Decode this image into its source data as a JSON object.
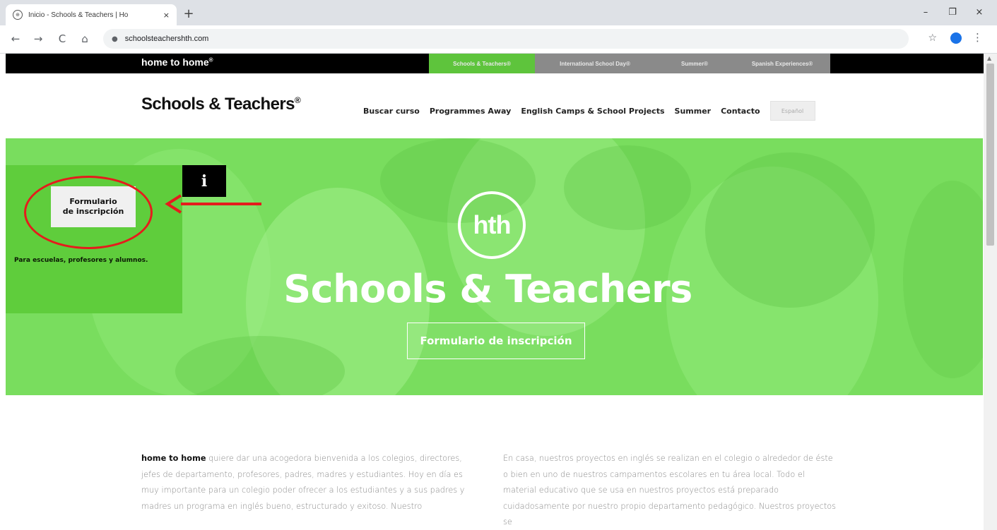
{
  "browser": {
    "tab": {
      "title": "Inicio - Schools & Teachers | Ho",
      "close": "×"
    },
    "new_tab": "+",
    "controls": {
      "minimize": "–",
      "restore": "❐",
      "close": "×"
    },
    "url": "schoolsteachershth.com",
    "nav": {
      "back": "←",
      "forward": "→",
      "reload": "C",
      "home": "⌂"
    },
    "star": "☆",
    "menu": "⋮"
  },
  "topbar": {
    "brand": "home to home",
    "brand_mark": "®",
    "tabs": [
      {
        "label": "Schools & Teachers®",
        "color": "#5ec43c"
      },
      {
        "label": "International School Day®",
        "color": "#8a8a8a"
      },
      {
        "label": "Summer®",
        "color": "#8a8a8a"
      },
      {
        "label": "Spanish Experiences®",
        "color": "#8a8a8a"
      }
    ]
  },
  "header": {
    "logo": "Schools & Teachers",
    "logo_mark": "®",
    "nav": [
      "Buscar curso",
      "Programmes Away",
      "English Camps & School Projects",
      "Summer",
      "Contacto"
    ],
    "language": "Español"
  },
  "hero": {
    "logo": "hth",
    "title": "Schools & Teachers",
    "button": "Formulario de inscripción"
  },
  "side_panel": {
    "info": "i",
    "form_button_line1": "Formulario",
    "form_button_line2": "de inscripción",
    "text": "Para escuelas, profesores y alumnos."
  },
  "content": {
    "left": {
      "lead": "home to home",
      "body": " quiere dar una acogedora bienvenida a los colegios, directores, jefes de departamento, profesores, padres, madres y estudiantes. Hoy en día es muy importante para un colegio poder ofrecer a los estudiantes y a sus padres y madres un programa en inglés bueno, estructurado y exitoso. Nuestro"
    },
    "right": {
      "body": "En casa, nuestros proyectos en inglés se realizan en el colegio o alrededor de éste o bien en uno de nuestros campamentos escolares en tu área local. Todo el material educativo que se usa en nuestros proyectos está preparado cuidadosamente por nuestro propio departamento pedagógico. Nuestros proyectos se"
    }
  },
  "colors": {
    "hero_green": "#79dd5e",
    "panel_green": "#5fcd3c",
    "annotation_red": "#e51c1c"
  }
}
